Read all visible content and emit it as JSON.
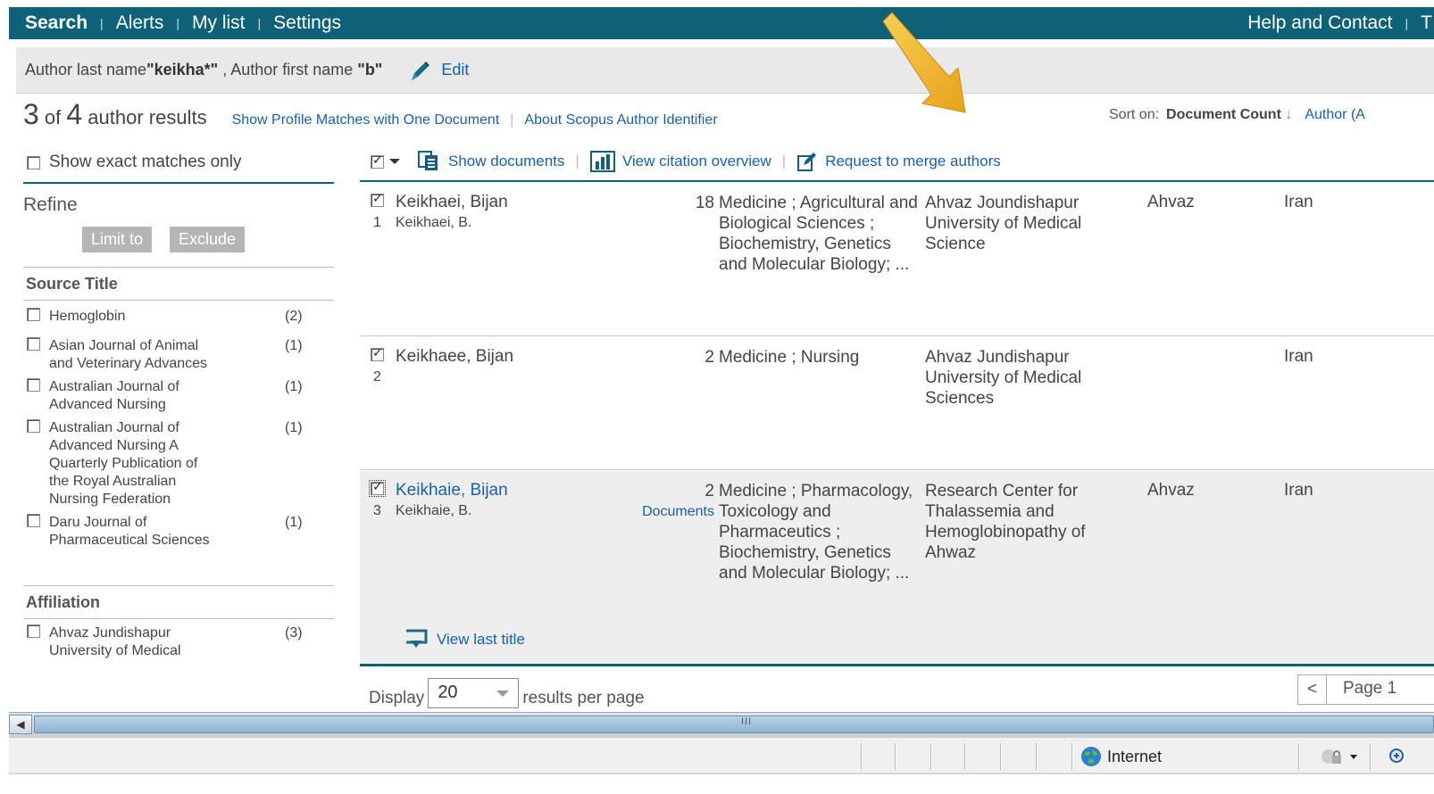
{
  "nav": {
    "left": [
      "Search",
      "Alerts",
      "My list",
      "Settings"
    ],
    "right": [
      "Help and Contact",
      "T"
    ]
  },
  "query": {
    "prefix1": "Author last name ",
    "value1": "\"keikha*\"",
    "prefix2": " , Author first name ",
    "value2": "\"b\"",
    "edit_label": "Edit"
  },
  "results": {
    "shown": "3",
    "of": " of ",
    "total": "4",
    "suffix": " author results",
    "link1": "Show Profile Matches with One Document",
    "link2": "About Scopus Author Identifier",
    "sort_label": "Sort on:",
    "sort_value": "Document Count",
    "sort_arrow": "↓",
    "sort_alt": "Author (A"
  },
  "left": {
    "exact_label": "Show exact matches only",
    "refine": "Refine",
    "limit_to": "Limit to",
    "exclude": "Exclude",
    "source_title": "Source Title",
    "sources": [
      {
        "name": "Hemoglobin",
        "count": "(2)"
      },
      {
        "name": "Asian Journal of Animal and Veterinary Advances",
        "count": "(1)"
      },
      {
        "name": "Australian Journal of Advanced Nursing",
        "count": "(1)"
      },
      {
        "name": "Australian Journal of Advanced Nursing A Quarterly Publication of the Royal Australian Nursing Federation",
        "count": "(1)"
      },
      {
        "name": "Daru Journal of Pharmaceutical Sciences",
        "count": "(1)"
      }
    ],
    "affiliation": "Affiliation",
    "affiliations": [
      {
        "name": "Ahvaz Jundishapur University of Medical",
        "count": "(3)"
      }
    ]
  },
  "toolbar": {
    "show_documents": "Show documents",
    "view_citation": "View citation overview",
    "merge": "Request to merge authors"
  },
  "rows": [
    {
      "num": "1",
      "name": "Keikhaei, Bijan",
      "alias": "Keikhaei, B.",
      "docs": "18",
      "subjects": "Medicine ; Agricultural and Biological Sciences ; Biochemistry, Genetics and Molecular Biology; ...",
      "affiliation": "Ahvaz Joundishapur University of Medical Science",
      "city": "Ahvaz",
      "country": "Iran"
    },
    {
      "num": "2",
      "name": "Keikhaee, Bijan",
      "alias": "",
      "docs": "2",
      "subjects": "Medicine ; Nursing",
      "affiliation": "Ahvaz Jundishapur University of Medical Sciences",
      "city": "",
      "country": "Iran"
    },
    {
      "num": "3",
      "name": "Keikhaie, Bijan",
      "alias": "Keikhaie, B.",
      "docs": "2",
      "docs_link": "Documents",
      "subjects": "Medicine ; Pharmacology, Toxicology and Pharmaceutics ; Biochemistry, Genetics and Molecular Biology; ...",
      "affiliation": "Research Center for Thalassemia and Hemoglobinopathy of Ahwaz",
      "city": "Ahvaz",
      "country": "Iran",
      "last_title": "View last title"
    }
  ],
  "footer": {
    "display": "Display",
    "per_page_value": "20",
    "per_page_suffix": "results per page",
    "page_label": "Page 1"
  },
  "browser": {
    "zone": "Internet",
    "scroll_grip": "III"
  },
  "colors": {
    "nav_bg": "#0e6177",
    "link": "#1a5fa8",
    "annotation_arrow": "#f0b020"
  }
}
